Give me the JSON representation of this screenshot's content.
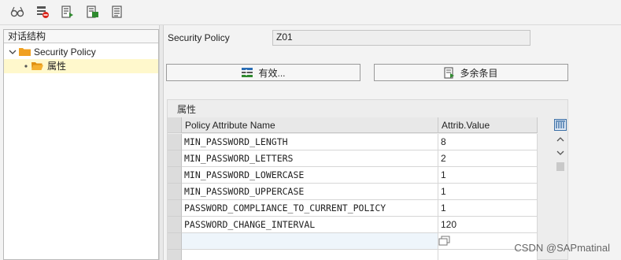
{
  "toolbar": {
    "buttons": [
      {
        "icon": "glasses-display-icon"
      },
      {
        "icon": "delete-entry-icon"
      },
      {
        "icon": "execute-entries-icon"
      },
      {
        "icon": "select-entries-icon"
      },
      {
        "icon": "document-list-icon"
      }
    ]
  },
  "tree": {
    "header": "对话结构",
    "items": [
      {
        "label": "Security Policy",
        "expanded": true
      },
      {
        "label": "属性",
        "selected": true
      }
    ]
  },
  "form": {
    "policy_label": "Security Policy",
    "policy_value": "Z01"
  },
  "buttons": {
    "valid_label": "有效...",
    "extra_label": "多余条目"
  },
  "group": {
    "title": "属性"
  },
  "table": {
    "columns": [
      "Policy Attribute Name",
      "Attrib.Value"
    ],
    "rows": [
      {
        "name": "MIN_PASSWORD_LENGTH",
        "value": "8"
      },
      {
        "name": "MIN_PASSWORD_LETTERS",
        "value": "2"
      },
      {
        "name": "MIN_PASSWORD_LOWERCASE",
        "value": "1"
      },
      {
        "name": "MIN_PASSWORD_UPPERCASE",
        "value": "1"
      },
      {
        "name": "PASSWORD_COMPLIANCE_TO_CURRENT_POLICY",
        "value": "1"
      },
      {
        "name": "PASSWORD_CHANGE_INTERVAL",
        "value": "120"
      },
      {
        "name": "",
        "value": ""
      }
    ]
  },
  "watermark": "CSDN @SAPmatinal",
  "colors": {
    "accent_blue": "#2a6db5",
    "folder_orange": "#f0a020",
    "selection_yellow": "#fff8cc"
  }
}
